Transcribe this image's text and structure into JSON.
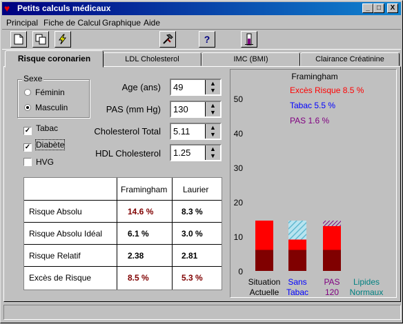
{
  "window": {
    "title": "Petits calculs médicaux",
    "minimize": "_",
    "maximize": "□",
    "close": "X"
  },
  "menu": [
    "Principal",
    "Fiche de Calcul",
    "Graphique",
    "Aide"
  ],
  "toolbar": {
    "icons": [
      "new-doc-icon",
      "copy-icon",
      "lightning-icon",
      "hammer-icon",
      "help-icon",
      "flask-icon"
    ],
    "help_glyph": "?"
  },
  "tabs": [
    "Risque coronarien",
    "LDL Cholesterol",
    "IMC (BMI)",
    "Clairance Créatinine"
  ],
  "form": {
    "sexe_legend": "Sexe",
    "feminin": "Féminin",
    "masculin": "Masculin",
    "selected_sexe": "Masculin",
    "tabac": {
      "label": "Tabac",
      "checked": true
    },
    "diabete": {
      "label": "Diabète",
      "checked": true
    },
    "hvg": {
      "label": "HVG",
      "checked": false
    },
    "age_label": "Age (ans)",
    "age_value": "49",
    "pas_label": "PAS (mm Hg)",
    "pas_value": "130",
    "chol_label": "Cholesterol Total",
    "chol_value": "5.11",
    "hdl_label": "HDL Cholesterol",
    "hdl_value": "1.25"
  },
  "results": {
    "headers": [
      "Framingham",
      "Laurier"
    ],
    "rows": [
      {
        "label": "Risque Absolu",
        "fram": "14.6 %",
        "laurier": "8.3 %"
      },
      {
        "label": "Risque Absolu Idéal",
        "fram": "6.1 %",
        "laurier": "3.0 %"
      },
      {
        "label": "Risque Relatif",
        "fram": "2.38",
        "laurier": "2.81"
      },
      {
        "label": "Excès de Risque",
        "fram": "8.5 %",
        "laurier": "5.3 %"
      }
    ]
  },
  "chart_data": {
    "type": "bar",
    "title": "Framingham",
    "annotations": [
      {
        "text": "Excès Risque 8.5 %",
        "color": "#ff0000"
      },
      {
        "text": "Tabac 5.5 %",
        "color": "#0000ff"
      },
      {
        "text": "PAS 1.6 %",
        "color": "#800080"
      }
    ],
    "ylim": [
      0,
      55
    ],
    "yticks": [
      0,
      10,
      20,
      30,
      40,
      50
    ],
    "categories": [
      {
        "line1": "Situation",
        "line2": "Actuelle",
        "color": "#000000"
      },
      {
        "line1": "Sans",
        "line2": "Tabac",
        "color": "#0000ff"
      },
      {
        "line1": "PAS",
        "line2": "120",
        "color": "#800080"
      },
      {
        "line1": "Lipides",
        "line2": "Normaux",
        "color": "#008080"
      }
    ],
    "series": [
      {
        "name": "Risque Absolu Idéal",
        "color": "#800000",
        "values": [
          6.1,
          6.1,
          6.1,
          0
        ]
      },
      {
        "name": "Excès de Risque",
        "color": "#ff0000",
        "values": [
          8.5,
          3.0,
          6.9,
          0
        ]
      },
      {
        "name": "Tabac",
        "color": "#9fd8e8",
        "values": [
          0,
          5.5,
          0,
          0
        ]
      },
      {
        "name": "PAS",
        "color": "#800080",
        "values": [
          0,
          0,
          1.6,
          0
        ]
      }
    ]
  }
}
